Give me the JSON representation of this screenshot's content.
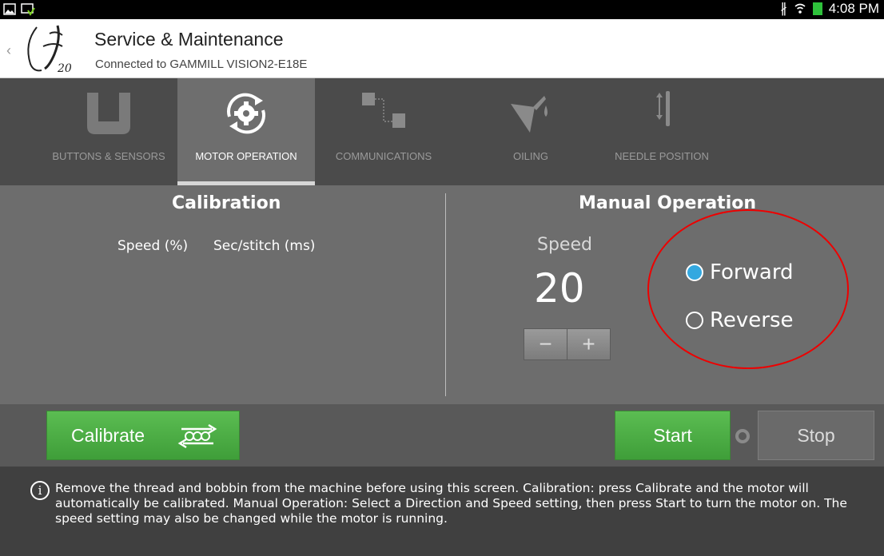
{
  "status_bar": {
    "time": "4:08 PM",
    "icons": [
      "gallery-icon",
      "download-icon",
      "bluetooth-icon",
      "wifi-icon",
      "battery-icon"
    ]
  },
  "header": {
    "title": "Service & Maintenance",
    "subtitle": "Connected to GAMMILL VISION2-E18E",
    "logo_text": "20"
  },
  "tabs": [
    {
      "label": "BUTTONS & SENSORS",
      "icon": "buttons-sensors-icon",
      "active": false
    },
    {
      "label": "MOTOR OPERATION",
      "icon": "motor-gear-icon",
      "active": true
    },
    {
      "label": "COMMUNICATIONS",
      "icon": "communications-icon",
      "active": false
    },
    {
      "label": "OILING",
      "icon": "oil-can-icon",
      "active": false
    },
    {
      "label": "NEEDLE POSITION",
      "icon": "needle-position-icon",
      "active": false
    }
  ],
  "calibration": {
    "title": "Calibration",
    "col_speed": "Speed (%)",
    "col_sec_stitch": "Sec/stitch (ms)"
  },
  "manual": {
    "title": "Manual Operation",
    "speed_label": "Speed",
    "speed_value": "20",
    "decrement": "−",
    "increment": "+",
    "direction_options": [
      {
        "label": "Forward",
        "checked": true
      },
      {
        "label": "Reverse",
        "checked": false
      }
    ]
  },
  "actions": {
    "calibrate": "Calibrate",
    "start": "Start",
    "stop": "Stop"
  },
  "info": {
    "text": "Remove the thread and bobbin from the machine before using this screen. Calibration: press Calibrate and the motor will automatically be calibrated. Manual Operation: Select a Direction and Speed setting, then press Start to turn the motor on. The speed setting may also be changed while the motor is running."
  },
  "colors": {
    "accent_green": "#4cae45",
    "radio_selected": "#33a8e0",
    "annotation_red": "#ee0000"
  }
}
